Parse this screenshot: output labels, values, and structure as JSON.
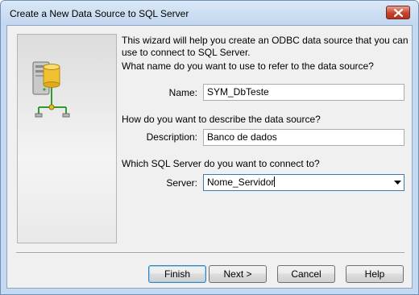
{
  "window": {
    "title": "Create a New Data Source to SQL Server"
  },
  "wizard": {
    "intro": "This wizard will help you create an ODBC data source that you can use to connect to SQL Server.",
    "name_question": "What name do you want to use to refer to the data source?",
    "name_label": "Name:",
    "name_value": "SYM_DbTeste",
    "description_question": "How do you want to describe the data source?",
    "description_label": "Description:",
    "description_value": "Banco de dados",
    "server_question": "Which SQL Server do you want to connect to?",
    "server_label": "Server:",
    "server_value": "Nome_Servidor"
  },
  "buttons": {
    "finish": "Finish",
    "next": "Next >",
    "cancel": "Cancel",
    "help": "Help"
  },
  "icons": {
    "close": "close-icon",
    "illustration": "database-server-icon",
    "dropdown": "chevron-down-icon"
  },
  "colors": {
    "title_bar": "#c5d9f1",
    "close_button": "#c7432e",
    "dialog_background": "#f0f0f0",
    "default_button_border": "#3c7fb1"
  }
}
